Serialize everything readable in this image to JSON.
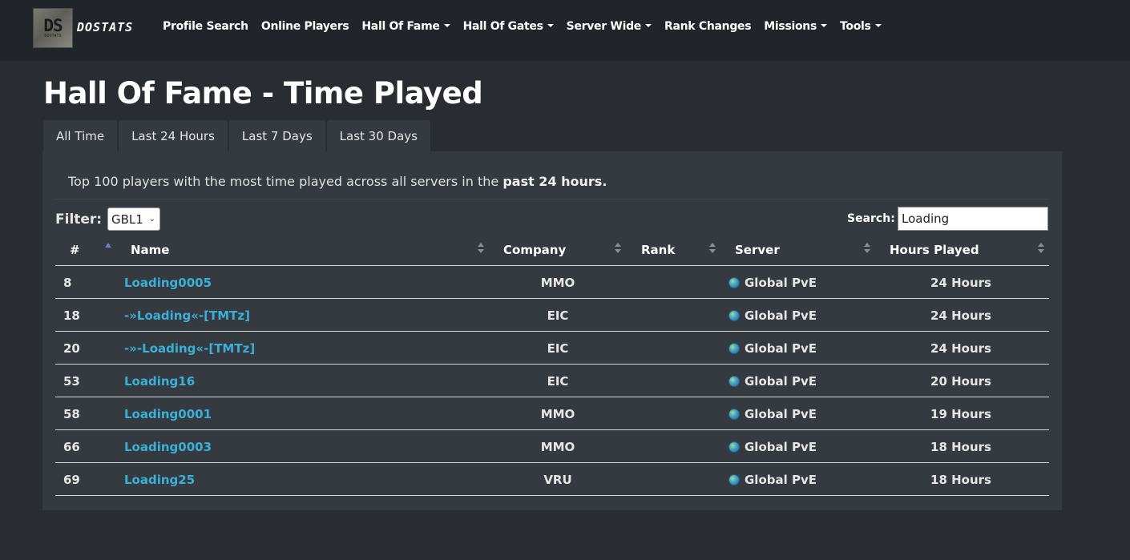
{
  "brand": {
    "logo_text": "DS",
    "logo_sub": "DOSTATS",
    "name": "DOSTATS"
  },
  "nav": [
    {
      "label": "Profile Search",
      "dropdown": false
    },
    {
      "label": "Online Players",
      "dropdown": false
    },
    {
      "label": "Hall Of Fame",
      "dropdown": true
    },
    {
      "label": "Hall Of Gates",
      "dropdown": true
    },
    {
      "label": "Server Wide",
      "dropdown": true
    },
    {
      "label": "Rank Changes",
      "dropdown": false
    },
    {
      "label": "Missions",
      "dropdown": true
    },
    {
      "label": "Tools",
      "dropdown": true
    }
  ],
  "page": {
    "title": "Hall Of Fame - Time Played"
  },
  "tabs": [
    "All Time",
    "Last 24 Hours",
    "Last 7 Days",
    "Last 30 Days"
  ],
  "description": {
    "text": "Top 100 players with the most time played across all servers in the ",
    "bold": "past 24 hours."
  },
  "filter": {
    "label": "Filter:",
    "value": "GBL1"
  },
  "search": {
    "label": "Search:",
    "value": "Loading"
  },
  "table": {
    "headers": {
      "rank": "#",
      "name": "Name",
      "company": "Company",
      "rank_col": "Rank",
      "server": "Server",
      "hours": "Hours Played"
    },
    "rows": [
      {
        "rank": "8",
        "name": "Loading0005",
        "company": "MMO",
        "server": "Global PvE",
        "hours": "24 Hours"
      },
      {
        "rank": "18",
        "name": "-»Loading«-[TMTz]",
        "company": "EIC",
        "server": "Global PvE",
        "hours": "24 Hours"
      },
      {
        "rank": "20",
        "name": "-»-Loading«-[TMTz]",
        "company": "EIC",
        "server": "Global PvE",
        "hours": "24 Hours"
      },
      {
        "rank": "53",
        "name": "Loading16",
        "company": "EIC",
        "server": "Global PvE",
        "hours": "20 Hours"
      },
      {
        "rank": "58",
        "name": "Loading0001",
        "company": "MMO",
        "server": "Global PvE",
        "hours": "19 Hours"
      },
      {
        "rank": "66",
        "name": "Loading0003",
        "company": "MMO",
        "server": "Global PvE",
        "hours": "18 Hours"
      },
      {
        "rank": "69",
        "name": "Loading25",
        "company": "VRU",
        "server": "Global PvE",
        "hours": "18 Hours"
      }
    ]
  },
  "colors": {
    "link": "#3bb0d6",
    "background": "#292c31",
    "navbar": "#212429",
    "card": "#343a40"
  }
}
